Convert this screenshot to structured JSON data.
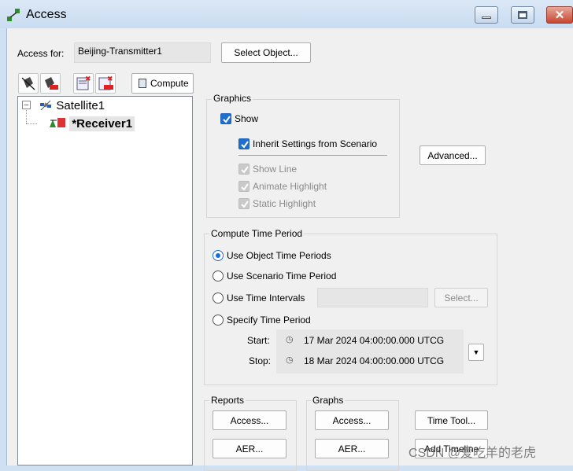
{
  "window": {
    "title": "Access"
  },
  "access_for": {
    "label": "Access for:",
    "value": "Beijing-Transmitter1",
    "select_button": "Select Object..."
  },
  "toolbar": {
    "compute_label": "Compute"
  },
  "tree": {
    "items": [
      {
        "label": "Satellite1",
        "expander": "⊟"
      },
      {
        "label": "*Receiver1"
      }
    ]
  },
  "graphics": {
    "title": "Graphics",
    "show": "Show",
    "inherit": "Inherit Settings from Scenario",
    "show_line": "Show Line",
    "animate_highlight": "Animate Highlight",
    "static_highlight": "Static Highlight",
    "advanced_button": "Advanced..."
  },
  "compute_time": {
    "title": "Compute Time Period",
    "options": [
      "Use Object Time Periods",
      "Use Scenario Time Period",
      "Use Time Intervals",
      "Specify Time Period"
    ],
    "selected": "Use Object Time Periods",
    "intervals_select": "Select...",
    "start_label": "Start:",
    "start_value": "17 Mar 2024 04:00:00.000 UTCG",
    "stop_label": "Stop:",
    "stop_value": "18 Mar 2024 04:00:00.000 UTCG"
  },
  "reports": {
    "title": "Reports",
    "access": "Access...",
    "aer": "AER..."
  },
  "graphs": {
    "title": "Graphs",
    "access": "Access...",
    "aer": "AER..."
  },
  "tools": {
    "time_tool": "Time Tool...",
    "add_timeline": "Add Timeline"
  },
  "watermark": "CSDN @爱吃羊的老虎",
  "colors": {
    "accent": "#1f6fd0",
    "titlebar": "#cfe0f3",
    "close": "#c7462f"
  }
}
